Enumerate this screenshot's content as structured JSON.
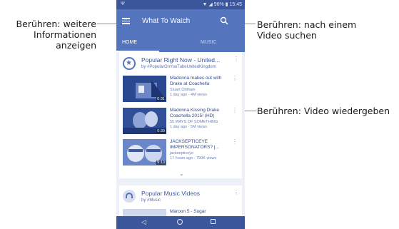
{
  "annotations": {
    "menu_line1": "Berühren: weitere",
    "menu_line2": "Informationen",
    "menu_line3": "anzeigen",
    "search_line1": "Berühren: nach einem",
    "search_line2": "Video suchen",
    "play": "Berühren: Video wiedergeben"
  },
  "status_bar": {
    "battery": "96%",
    "time": "15:45"
  },
  "app_bar": {
    "title": "What To Watch"
  },
  "tabs": [
    {
      "label": "HOME",
      "selected": true
    },
    {
      "label": "MUSIC",
      "selected": false
    }
  ],
  "shelves": [
    {
      "title": "Popular Right Now - United...",
      "subtitle": "by #PopularOnYouTubeUnitedKingdom",
      "videos": [
        {
          "title": "Madonna makes out with Drake at Coachella",
          "channel": "Stuart Oldham",
          "meta": "1 day ago · 4M views",
          "duration": "0:31"
        },
        {
          "title": "Madonna Kissing Drake Coachella 2015! (HD)",
          "channel": "55 WAYS OF SOMETHING",
          "meta": "1 day ago · 5M views",
          "duration": "0:30"
        },
        {
          "title": "JACKSEPTICEYE IMPERSONATORS? |...",
          "channel": "jacksepticeye",
          "meta": "17 hours ago · 790K views",
          "duration": "9:13"
        }
      ]
    },
    {
      "title": "Popular Music Videos",
      "subtitle": "by #Music",
      "peek_title": "Maroon 5 - Sugar"
    }
  ],
  "colors": {
    "primary": "#5474bd",
    "primary_dark": "#3c569b",
    "leader_line": "#e07a2c"
  }
}
